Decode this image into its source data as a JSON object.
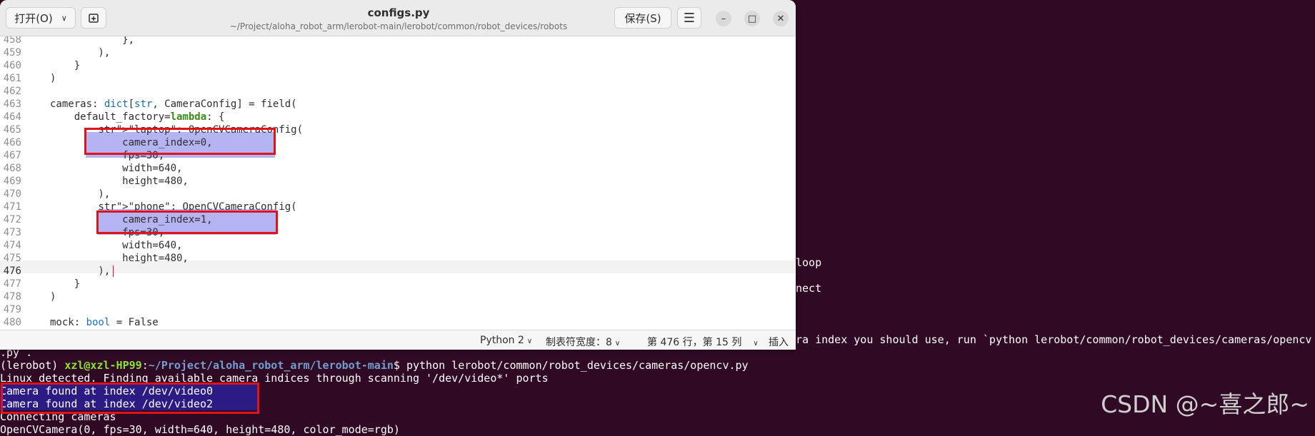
{
  "terminal": {
    "right_lines": [
      {
        "text": "loop"
      },
      {
        "text": "nect"
      },
      {
        "text": "ra index you should use, run `python lerobot/common/robot_devices/cameras/opencv"
      }
    ],
    "cont_line": ".py .",
    "prompt": {
      "env": "(lerobot) ",
      "userhost": "xzl@xzl-HP99",
      "sep": ":",
      "path": "~/Project/aloha_robot_arm/lerobot-main",
      "command": "$ python lerobot/common/robot_devices/cameras/opencv.py"
    },
    "output": [
      "Linux detected. Finding available camera indices through scanning '/dev/video*' ports",
      "Camera found at index /dev/video0",
      "Camera found at index /dev/video2",
      "Connecting cameras",
      "OpenCVCamera(0, fps=30, width=640, height=480, color_mode=rgb)"
    ],
    "watermark": "CSDN @~喜之郎~"
  },
  "editor": {
    "open_label": "打开(O)",
    "title": "configs.py",
    "path": "~/Project/aloha_robot_arm/lerobot-main/lerobot/common/robot_devices/robots",
    "save_label": "保存(S)",
    "menu_icon": "hamburger-menu-icon",
    "code_lines": [
      {
        "num": "458",
        "text": "            },"
      },
      {
        "num": "459",
        "text": "        ),"
      },
      {
        "num": "460",
        "text": "    }"
      },
      {
        "num": "461",
        "text": ")"
      },
      {
        "num": "462",
        "text": ""
      },
      {
        "num": "463",
        "text": "cameras: dict[str, CameraConfig] = field("
      },
      {
        "num": "464",
        "text": "    default_factory=lambda: {"
      },
      {
        "num": "465",
        "text": "        \"laptop\": OpenCVCameraConfig("
      },
      {
        "num": "466",
        "text": "            camera_index=0,"
      },
      {
        "num": "467",
        "text": "            fps=30,"
      },
      {
        "num": "468",
        "text": "            width=640,"
      },
      {
        "num": "469",
        "text": "            height=480,"
      },
      {
        "num": "470",
        "text": "        ),"
      },
      {
        "num": "471",
        "text": "        \"phone\": OpenCVCameraConfig("
      },
      {
        "num": "472",
        "text": "            camera_index=1,"
      },
      {
        "num": "473",
        "text": "            fps=30,"
      },
      {
        "num": "474",
        "text": "            width=640,"
      },
      {
        "num": "475",
        "text": "            height=480,"
      },
      {
        "num": "476",
        "text": "        ),"
      },
      {
        "num": "477",
        "text": "    }"
      },
      {
        "num": "478",
        "text": ")"
      },
      {
        "num": "479",
        "text": ""
      },
      {
        "num": "480",
        "text": "mock: bool = False"
      }
    ],
    "status": {
      "language": "Python 2",
      "tab_width": "制表符宽度：8",
      "position": "第 476 行，第 15 列",
      "mode": "插入"
    }
  },
  "colors": {
    "terminal_bg": "#300a24",
    "selection": "#b4b4f2",
    "annotation_box": "#e0131b",
    "keyword": "#3a8a1a",
    "string": "#e0921a",
    "builtin": "#1b6fad"
  }
}
